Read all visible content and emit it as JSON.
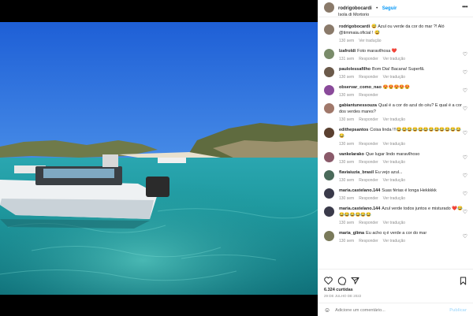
{
  "post": {
    "author": "rodrigobocardi",
    "follow_label": "Seguir",
    "location": "Isola di Mortorio",
    "caption": {
      "user": "rodrigobocardi",
      "text": "😅 Azul ou verde da cor do mar ?! Aló @timmaia.oficial ! 😅",
      "time": "130 sem",
      "reply": "Ver tradução"
    }
  },
  "comments": [
    {
      "user": "lzafroldi",
      "text": "Foto maravilhosa ❤️",
      "time": "131 sem",
      "reply": "Responder",
      "translate": "Ver tradução",
      "avatar_color": "#7a8c6a"
    },
    {
      "user": "paulolessafilho",
      "text": "Bom Dia! Bacana! Superfã.",
      "time": "130 sem",
      "reply": "Responder",
      "translate": "Ver tradução",
      "avatar_color": "#6b5a4a"
    },
    {
      "user": "observar_como_nao",
      "text": "😍😍😍😍😍",
      "time": "130 sem",
      "reply": "Responder",
      "translate": "",
      "avatar_color": "#8a4a9a"
    },
    {
      "user": "gabiantunessouza",
      "text": "Qual é a cor do azul do céu? E qual é a cor dos verdes mares?",
      "time": "130 sem",
      "reply": "Responder",
      "translate": "Ver tradução",
      "avatar_color": "#a0786a"
    },
    {
      "user": "edithepsantos",
      "text": "Coisa linda !!!😂😂😂😂😂😂😂😂😂😂😂😂😂",
      "time": "130 sem",
      "reply": "Responder",
      "translate": "Ver tradução",
      "avatar_color": "#5a4030"
    },
    {
      "user": "vankelarako",
      "text": "Que lugar lindo maravilhoso",
      "time": "130 sem",
      "reply": "Responder",
      "translate": "Ver tradução",
      "avatar_color": "#8a5a6a"
    },
    {
      "user": "flaviaiuzia_brasil",
      "text": "Eu vejo azul...",
      "time": "130 sem",
      "reply": "Responder",
      "translate": "Ver tradução",
      "avatar_color": "#4a6a5a"
    },
    {
      "user": "maria.castelano.144",
      "text": "Suas férias é longa Hekkkkk",
      "time": "130 sem",
      "reply": "Responder",
      "translate": "Ver tradução",
      "avatar_color": "#3a3a4a"
    },
    {
      "user": "maria.castelano.144",
      "text": "Azul verde todos juntos e misturado ❤️😂😂😂😂😂😂😂",
      "time": "130 sem",
      "reply": "Responder",
      "translate": "Ver tradução",
      "avatar_color": "#3a3a4a"
    },
    {
      "user": "maria_glima",
      "text": "Eu acho q é verde a cor do mar",
      "time": "130 sem",
      "reply": "Responder",
      "translate": "Ver tradução",
      "avatar_color": "#7a7a5a"
    }
  ],
  "footer": {
    "likes": "6.324 curtidas",
    "date": "29 de julho de 2022",
    "add_comment_placeholder": "Adicione um comentário...",
    "publish_label": "Publicar"
  },
  "icons": {
    "more": "more-horizontal-icon",
    "heart": "heart-icon",
    "comment": "comment-icon",
    "share": "share-icon",
    "save": "bookmark-icon",
    "emoji": "emoji-icon"
  },
  "colors": {
    "link": "#0095f6",
    "muted": "#8e8e8e",
    "text": "#262626",
    "publish_disabled": "#b2dffc"
  }
}
